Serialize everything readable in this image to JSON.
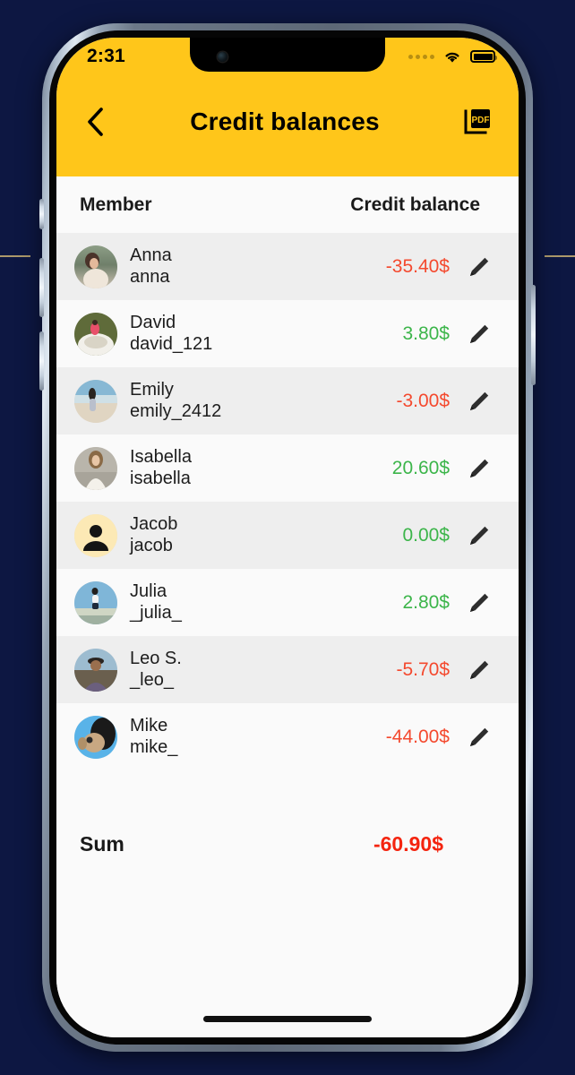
{
  "status_bar": {
    "time": "2:31",
    "signal_icon": "signal-dots-icon",
    "wifi_icon": "wifi-icon",
    "battery_icon": "battery-full-icon"
  },
  "nav": {
    "back_icon": "chevron-left-icon",
    "title": "Credit balances",
    "pdf_icon": "pdf-export-icon"
  },
  "table": {
    "columns": {
      "member": "Member",
      "balance": "Credit balance"
    },
    "rows": [
      {
        "name": "Anna",
        "handle": "anna",
        "amount": "-35.40$",
        "sign": "neg",
        "avatar": "photo-woman-field",
        "edit_icon": "pencil-icon"
      },
      {
        "name": "David",
        "handle": "david_121",
        "amount": "3.80$",
        "sign": "pos",
        "avatar": "photo-man-boat",
        "edit_icon": "pencil-icon"
      },
      {
        "name": "Emily",
        "handle": "emily_2412",
        "amount": "-3.00$",
        "sign": "neg",
        "avatar": "photo-woman-beach",
        "edit_icon": "pencil-icon"
      },
      {
        "name": "Isabella",
        "handle": "isabella",
        "amount": "20.60$",
        "sign": "pos",
        "avatar": "photo-woman-white",
        "edit_icon": "pencil-icon"
      },
      {
        "name": "Jacob",
        "handle": "jacob",
        "amount": "0.00$",
        "sign": "pos",
        "avatar": "placeholder-person",
        "edit_icon": "pencil-icon"
      },
      {
        "name": "Julia",
        "handle": "_julia_",
        "amount": "2.80$",
        "sign": "pos",
        "avatar": "photo-woman-jump",
        "edit_icon": "pencil-icon"
      },
      {
        "name": "Leo S.",
        "handle": "_leo_",
        "amount": "-5.70$",
        "sign": "neg",
        "avatar": "photo-man-hat",
        "edit_icon": "pencil-icon"
      },
      {
        "name": "Mike",
        "handle": "mike_",
        "amount": "-44.00$",
        "sign": "neg",
        "avatar": "photo-man-dog",
        "edit_icon": "pencil-icon"
      }
    ]
  },
  "summary": {
    "label": "Sum",
    "value": "-60.90$"
  },
  "colors": {
    "header_yellow": "#FFC61A",
    "negative": "#f4492e",
    "positive": "#3cb54a",
    "sum_negative": "#f4240f",
    "row_alt": "#eeeeee",
    "row_base": "#fafafa",
    "page_background": "#0d1742"
  }
}
